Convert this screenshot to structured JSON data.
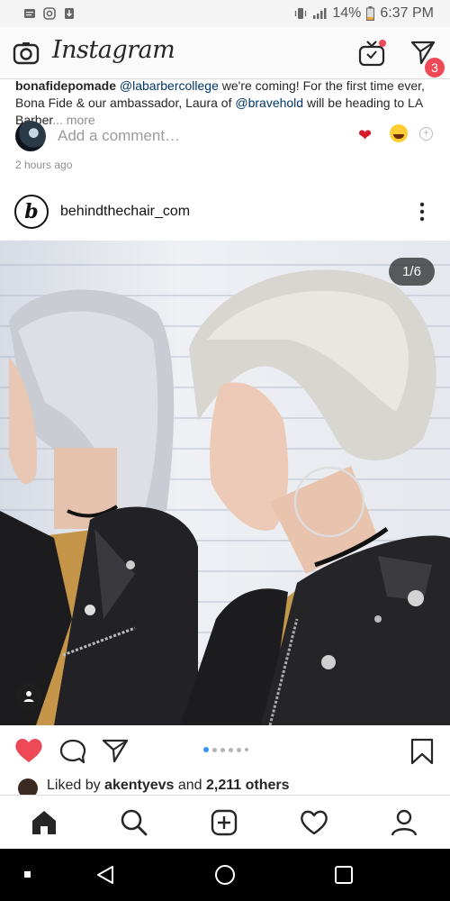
{
  "status_bar": {
    "battery": "14%",
    "time": "6:37 PM",
    "network": "LTE"
  },
  "header": {
    "logo_text": "Instagram",
    "direct_badge": "3"
  },
  "previous_post": {
    "caption_user": "bonafidepomade",
    "caption_mention_1": "@labarbercollege",
    "caption_text_1": " we're coming! For the first time ever, Bona Fide & our ambassador, Laura of ",
    "caption_mention_2": "@bravehold",
    "caption_text_2": " will be heading to LA Barber",
    "caption_more": "... more",
    "comment_placeholder": "Add a comment…",
    "timestamp": "2 hours ago"
  },
  "post": {
    "avatar_letter": "b",
    "username": "behindthechair_com",
    "counter": "1/6",
    "carousel_dots": 6,
    "carousel_active": 1
  },
  "likes": {
    "prefix": "Liked by ",
    "user": "akentyevs",
    "middle": " and ",
    "count": "2,211 others"
  },
  "icons": {
    "camera": "camera-icon",
    "igtv": "igtv-icon",
    "direct": "direct-icon",
    "more": "more-icon",
    "like": "heart-icon",
    "comment": "comment-icon",
    "share": "share-icon",
    "save": "bookmark-icon",
    "tag": "user-tag-icon",
    "home": "home-icon",
    "search": "search-icon",
    "add": "add-post-icon",
    "activity": "activity-heart-icon",
    "profile": "profile-icon"
  },
  "colors": {
    "like_red": "#ed4956",
    "active_dot": "#3897f0",
    "mention": "#003569",
    "muted": "#8e8e8e"
  }
}
